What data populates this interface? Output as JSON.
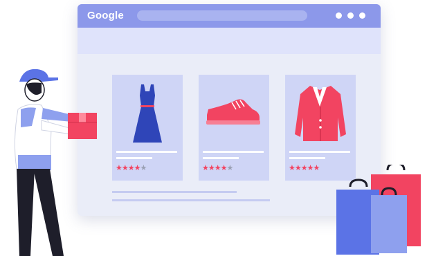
{
  "browser": {
    "brand": "Google",
    "window_controls": [
      "dot",
      "dot",
      "dot"
    ]
  },
  "products": [
    {
      "name": "dress",
      "icon": "dress-icon",
      "rating": 4,
      "max_rating": 5
    },
    {
      "name": "sneaker",
      "icon": "sneaker-icon",
      "rating": 4,
      "max_rating": 5
    },
    {
      "name": "blazer",
      "icon": "blazer-icon",
      "rating": 5,
      "max_rating": 5
    }
  ],
  "colors": {
    "accent": "#8c98ea",
    "star": "#f24461",
    "dress": "#2f45b8",
    "sneaker": "#f24461",
    "blazer": "#f24461"
  },
  "illustration": {
    "person": "delivery-person-icon",
    "package": "package-box-icon",
    "bags": "shopping-bags-icon"
  }
}
